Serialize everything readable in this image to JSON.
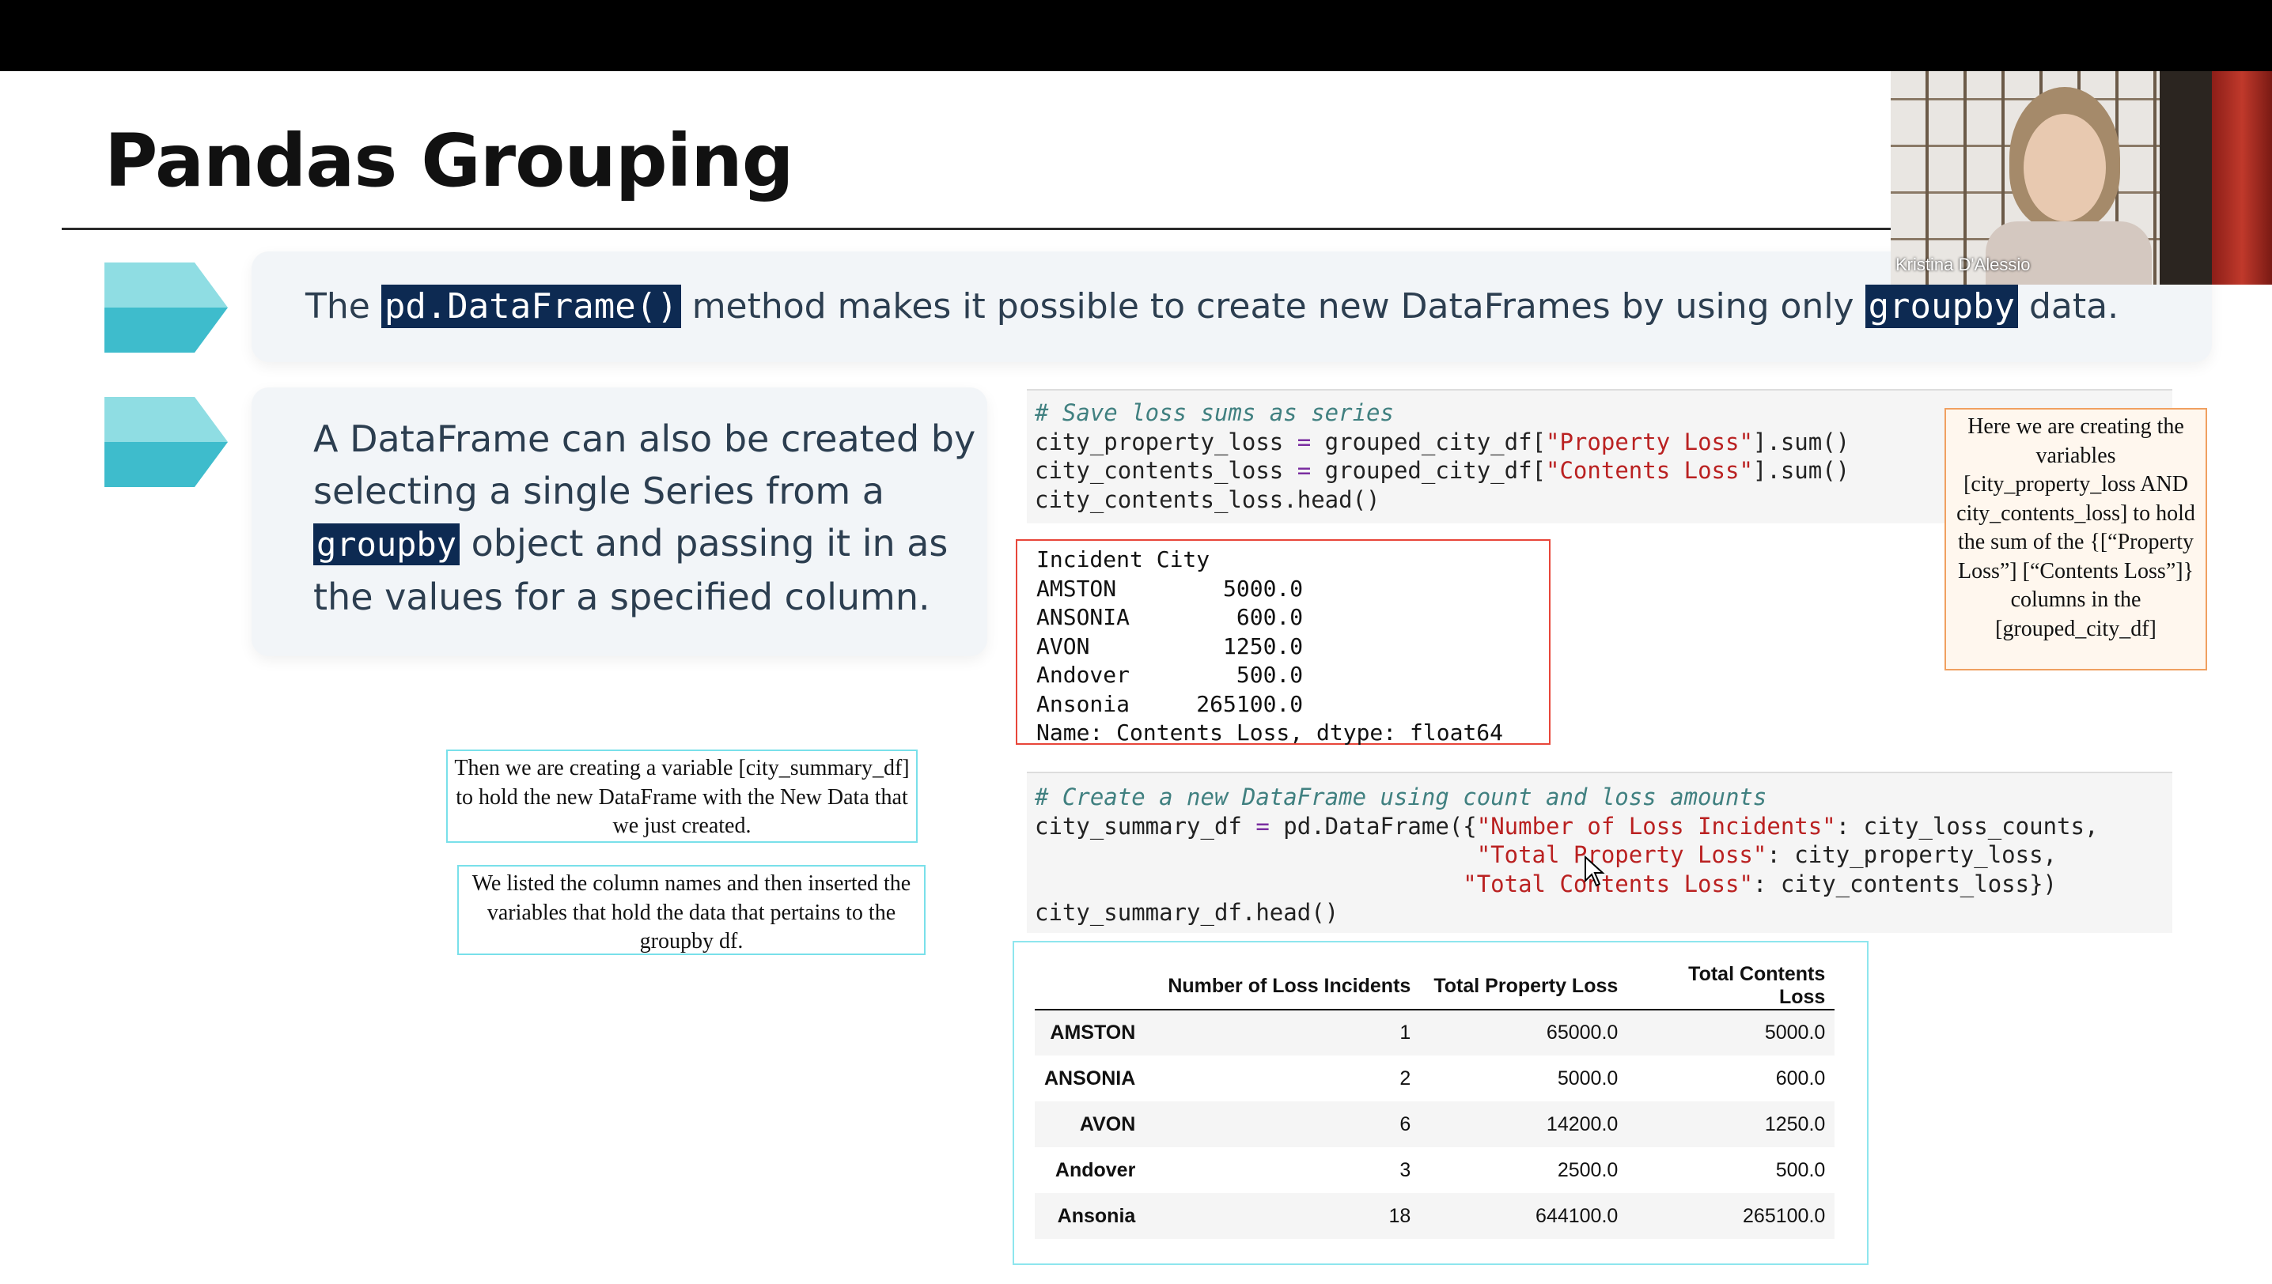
{
  "slide": {
    "title": "Pandas Grouping",
    "bullet1": {
      "text_before": "The ",
      "code1": "pd.DataFrame()",
      "text_middle": " method makes it possible to create new DataFrames by using only ",
      "code2": "groupby",
      "text_after": " data."
    },
    "bullet2": {
      "text_before": "A DataFrame can also be created by selecting a single Series from a ",
      "code": "groupby",
      "text_after": " object and passing it in as the values for a specified column."
    },
    "arrow_colors": {
      "light": "#8fdde3",
      "dark": "#3ebccc"
    }
  },
  "code_cell_1": {
    "comment": "# Save loss sums as series",
    "line2_a": "city_property_loss ",
    "line2_op": "=",
    "line2_b": " grouped_city_df[",
    "line2_str": "\"Property Loss\"",
    "line2_c": "].sum()",
    "line3_a": "city_contents_loss ",
    "line3_op": "=",
    "line3_b": " grouped_city_df[",
    "line3_str": "\"Contents Loss\"",
    "line3_c": "].sum()",
    "line4": "city_contents_loss.head()"
  },
  "output_1": {
    "lines": [
      "Incident City",
      "AMSTON        5000.0",
      "ANSONIA        600.0",
      "AVON          1250.0",
      "Andover        500.0",
      "Ansonia     265100.0",
      "Name: Contents Loss, dtype: float64"
    ]
  },
  "code_cell_2": {
    "comment": "# Create a new DataFrame using count and loss amounts",
    "line2_a": "city_summary_df ",
    "line2_op": "=",
    "line2_b": " pd.DataFrame({",
    "line2_str": "\"Number of Loss Incidents\"",
    "line2_c": ": city_loss_counts,",
    "line3_pad": "                                ",
    "line3_str": "\"Total Property Loss\"",
    "line3_c": ": city_property_loss,",
    "line4_pad": "                               ",
    "line4_str": "\"Total Contents Loss\"",
    "line4_c": ": city_contents_loss})",
    "line5": "city_summary_df.head()"
  },
  "notes": {
    "orange": "Here we are creating the variables [city_property_loss AND city_contents_loss] to hold the sum of the {[“Property Loss”] [“Contents Loss”]} columns in the [grouped_city_df]",
    "cyan1": "Then we are creating a variable [city_summary_df] to hold the new DataFrame with the New Data that we just created.",
    "cyan2": "We listed the column names and then inserted the variables that hold the data that pertains to the groupby df."
  },
  "summary_table": {
    "columns": [
      "",
      "Number of Loss Incidents",
      "Total Property Loss",
      "Total Contents Loss"
    ],
    "rows": [
      {
        "city": "AMSTON",
        "incidents": "1",
        "property": "65000.0",
        "contents": "5000.0"
      },
      {
        "city": "ANSONIA",
        "incidents": "2",
        "property": "5000.0",
        "contents": "600.0"
      },
      {
        "city": "AVON",
        "incidents": "6",
        "property": "14200.0",
        "contents": "1250.0"
      },
      {
        "city": "Andover",
        "incidents": "3",
        "property": "2500.0",
        "contents": "500.0"
      },
      {
        "city": "Ansonia",
        "incidents": "18",
        "property": "644100.0",
        "contents": "265100.0"
      }
    ]
  },
  "video": {
    "participant_name": "Kristina D'Alessio"
  }
}
